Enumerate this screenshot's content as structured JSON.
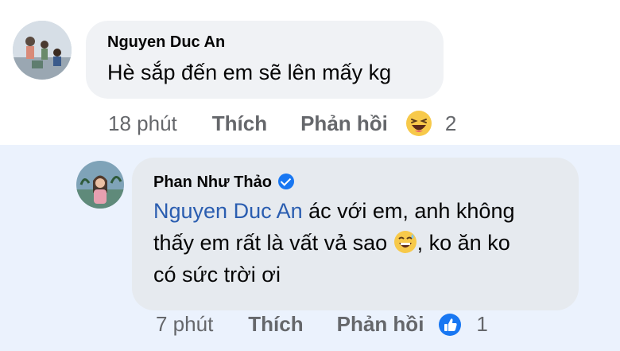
{
  "comment": {
    "author": "Nguyen Duc An",
    "text": "Hè sắp đến em sẽ lên mấy kg",
    "time": "18 phút",
    "like_label": "Thích",
    "reply_label": "Phản hồi",
    "reaction_icon": "laughing-emoji-icon",
    "reaction_count": "2"
  },
  "reply": {
    "author": "Phan Như Thảo",
    "verified_icon": "verified-badge-icon",
    "mention": "Nguyen Duc An",
    "text_line1": " ác với em, anh không",
    "text_line2a": "thấy em rất là vất vả sao ",
    "text_line2b": ", ko ăn ko",
    "text_line3": "có sức trời ơi",
    "inline_emoji": "grinning-sweat-emoji-icon",
    "time": "7 phút",
    "like_label": "Thích",
    "reply_label": "Phản hồi",
    "reaction_icon": "like-thumbs-up-icon",
    "reaction_count": "1"
  },
  "colors": {
    "reply_background": "#ebf2fd",
    "mention": "#2a5db0",
    "like_blue": "#1877f2",
    "muted_text": "#65676b"
  }
}
